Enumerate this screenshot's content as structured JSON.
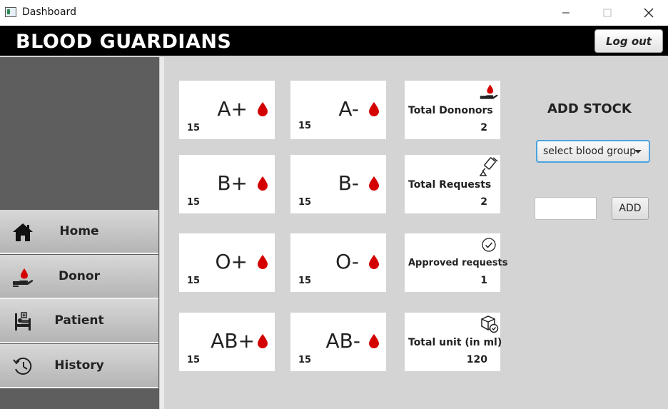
{
  "window": {
    "title": "Dashboard"
  },
  "header": {
    "brand": "BLOOD GUARDIANS",
    "logout_label": "Log out"
  },
  "sidebar": {
    "items": [
      {
        "label": "Home",
        "icon": "home-icon"
      },
      {
        "label": "Donor",
        "icon": "donor-hand-icon"
      },
      {
        "label": "Patient",
        "icon": "patient-bed-icon"
      },
      {
        "label": "History",
        "icon": "history-icon"
      }
    ]
  },
  "blood_groups": [
    {
      "group": "A+",
      "count": "15"
    },
    {
      "group": "A-",
      "count": "15"
    },
    {
      "group": "B+",
      "count": "15"
    },
    {
      "group": "B-",
      "count": "15"
    },
    {
      "group": "O+",
      "count": "15"
    },
    {
      "group": "O-",
      "count": "15"
    },
    {
      "group": "AB+",
      "count": "15"
    },
    {
      "group": "AB-",
      "count": "15"
    }
  ],
  "stats": {
    "total_donors": {
      "label": "Total Dononors",
      "value": "2",
      "icon": "donor-hand-icon"
    },
    "total_requests": {
      "label": "Total Requests",
      "value": "2",
      "icon": "blood-bag-icon"
    },
    "approved_requests": {
      "label": "Approved requests",
      "value": "1",
      "icon": "check-circle-icon"
    },
    "total_unit": {
      "label": "Total unit (in ml)",
      "value": "120",
      "icon": "box-check-icon"
    }
  },
  "add_stock": {
    "title": "ADD STOCK",
    "select_value": "select blood group",
    "input_value": "",
    "add_label": "ADD"
  },
  "colors": {
    "blood_red": "#d40000",
    "header_bg": "#000000",
    "sidebar_bg": "#5e5e5e",
    "focus_blue": "#4aa3df"
  }
}
